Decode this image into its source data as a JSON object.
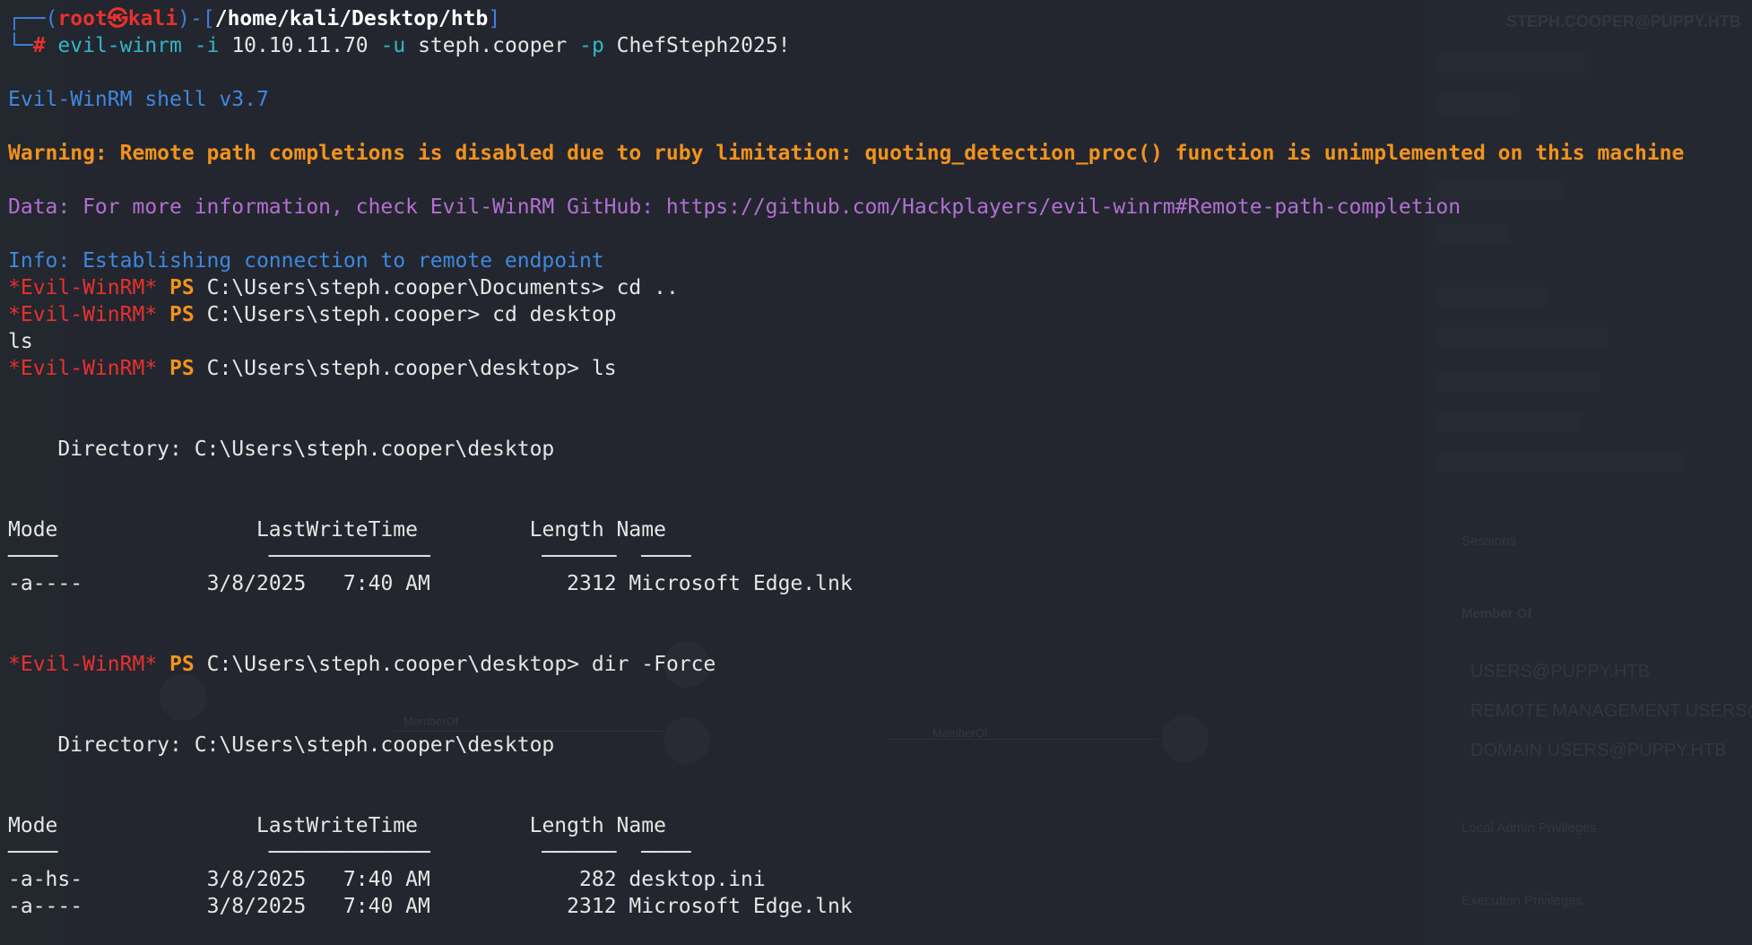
{
  "prompt": {
    "user": "root",
    "sep": "㉿",
    "host": "kali",
    "path": "/home/kali/Desktop/htb",
    "command_bin": "evil-winrm",
    "arg_i": "-i",
    "ip": "10.10.11.70",
    "arg_u": "-u",
    "user_arg": "steph.cooper",
    "arg_p": "-p",
    "pass_arg": "ChefSteph2025!"
  },
  "banner": {
    "shell": "Evil-WinRM shell v3.7",
    "warning": "Warning: Remote path completions is disabled due to ruby limitation: quoting_detection_proc() function is unimplemented on this machine",
    "data": "Data: For more information, check Evil-WinRM GitHub: https://github.com/Hackplayers/evil-winrm#Remote-path-completion",
    "info": "Info: Establishing connection to remote endpoint"
  },
  "session": {
    "tag": "*Evil-WinRM*",
    "ps": "PS",
    "lines": [
      {
        "path": "C:\\Users\\steph.cooper\\Documents>",
        "cmd": "cd .."
      },
      {
        "path": "C:\\Users\\steph.cooper>",
        "cmd": "cd desktop"
      }
    ],
    "echo_ls": "ls",
    "ls_line": {
      "path": "C:\\Users\\steph.cooper\\desktop>",
      "cmd": "ls"
    },
    "dir_line": {
      "path": "C:\\Users\\steph.cooper\\desktop>",
      "cmd": "dir -Force"
    }
  },
  "listing1": {
    "directory": "    Directory: C:\\Users\\steph.cooper\\desktop",
    "headers": {
      "mode": "Mode",
      "lwt": "LastWriteTime",
      "length": "Length",
      "name": "Name"
    },
    "rows": [
      {
        "mode": "-a----",
        "date": "3/8/2025",
        "time": "7:40 AM",
        "length": "2312",
        "name": "Microsoft Edge.lnk"
      }
    ]
  },
  "listing2": {
    "directory": "    Directory: C:\\Users\\steph.cooper\\desktop",
    "headers": {
      "mode": "Mode",
      "lwt": "LastWriteTime",
      "length": "Length",
      "name": "Name"
    },
    "rows": [
      {
        "mode": "-a-hs-",
        "date": "3/8/2025",
        "time": "7:40 AM",
        "length": "282",
        "name": "desktop.ini"
      },
      {
        "mode": "-a----",
        "date": "3/8/2025",
        "time": "7:40 AM",
        "length": "2312",
        "name": "Microsoft Edge.lnk"
      }
    ]
  },
  "background": {
    "user_node": "STEPH.COOPER@PUPPY.HTB",
    "member_of_title": "Member Of",
    "sessions": "Sessions",
    "groups": [
      "USERS@PUPPY.HTB",
      "REMOTE MANAGEMENT USERS@PUPPY.HTB",
      "DOMAIN USERS@PUPPY.HTB"
    ],
    "local_admin": "Local Admin Privileges",
    "exec_priv": "Execution Privileges",
    "edge_label": "MemberOf"
  }
}
